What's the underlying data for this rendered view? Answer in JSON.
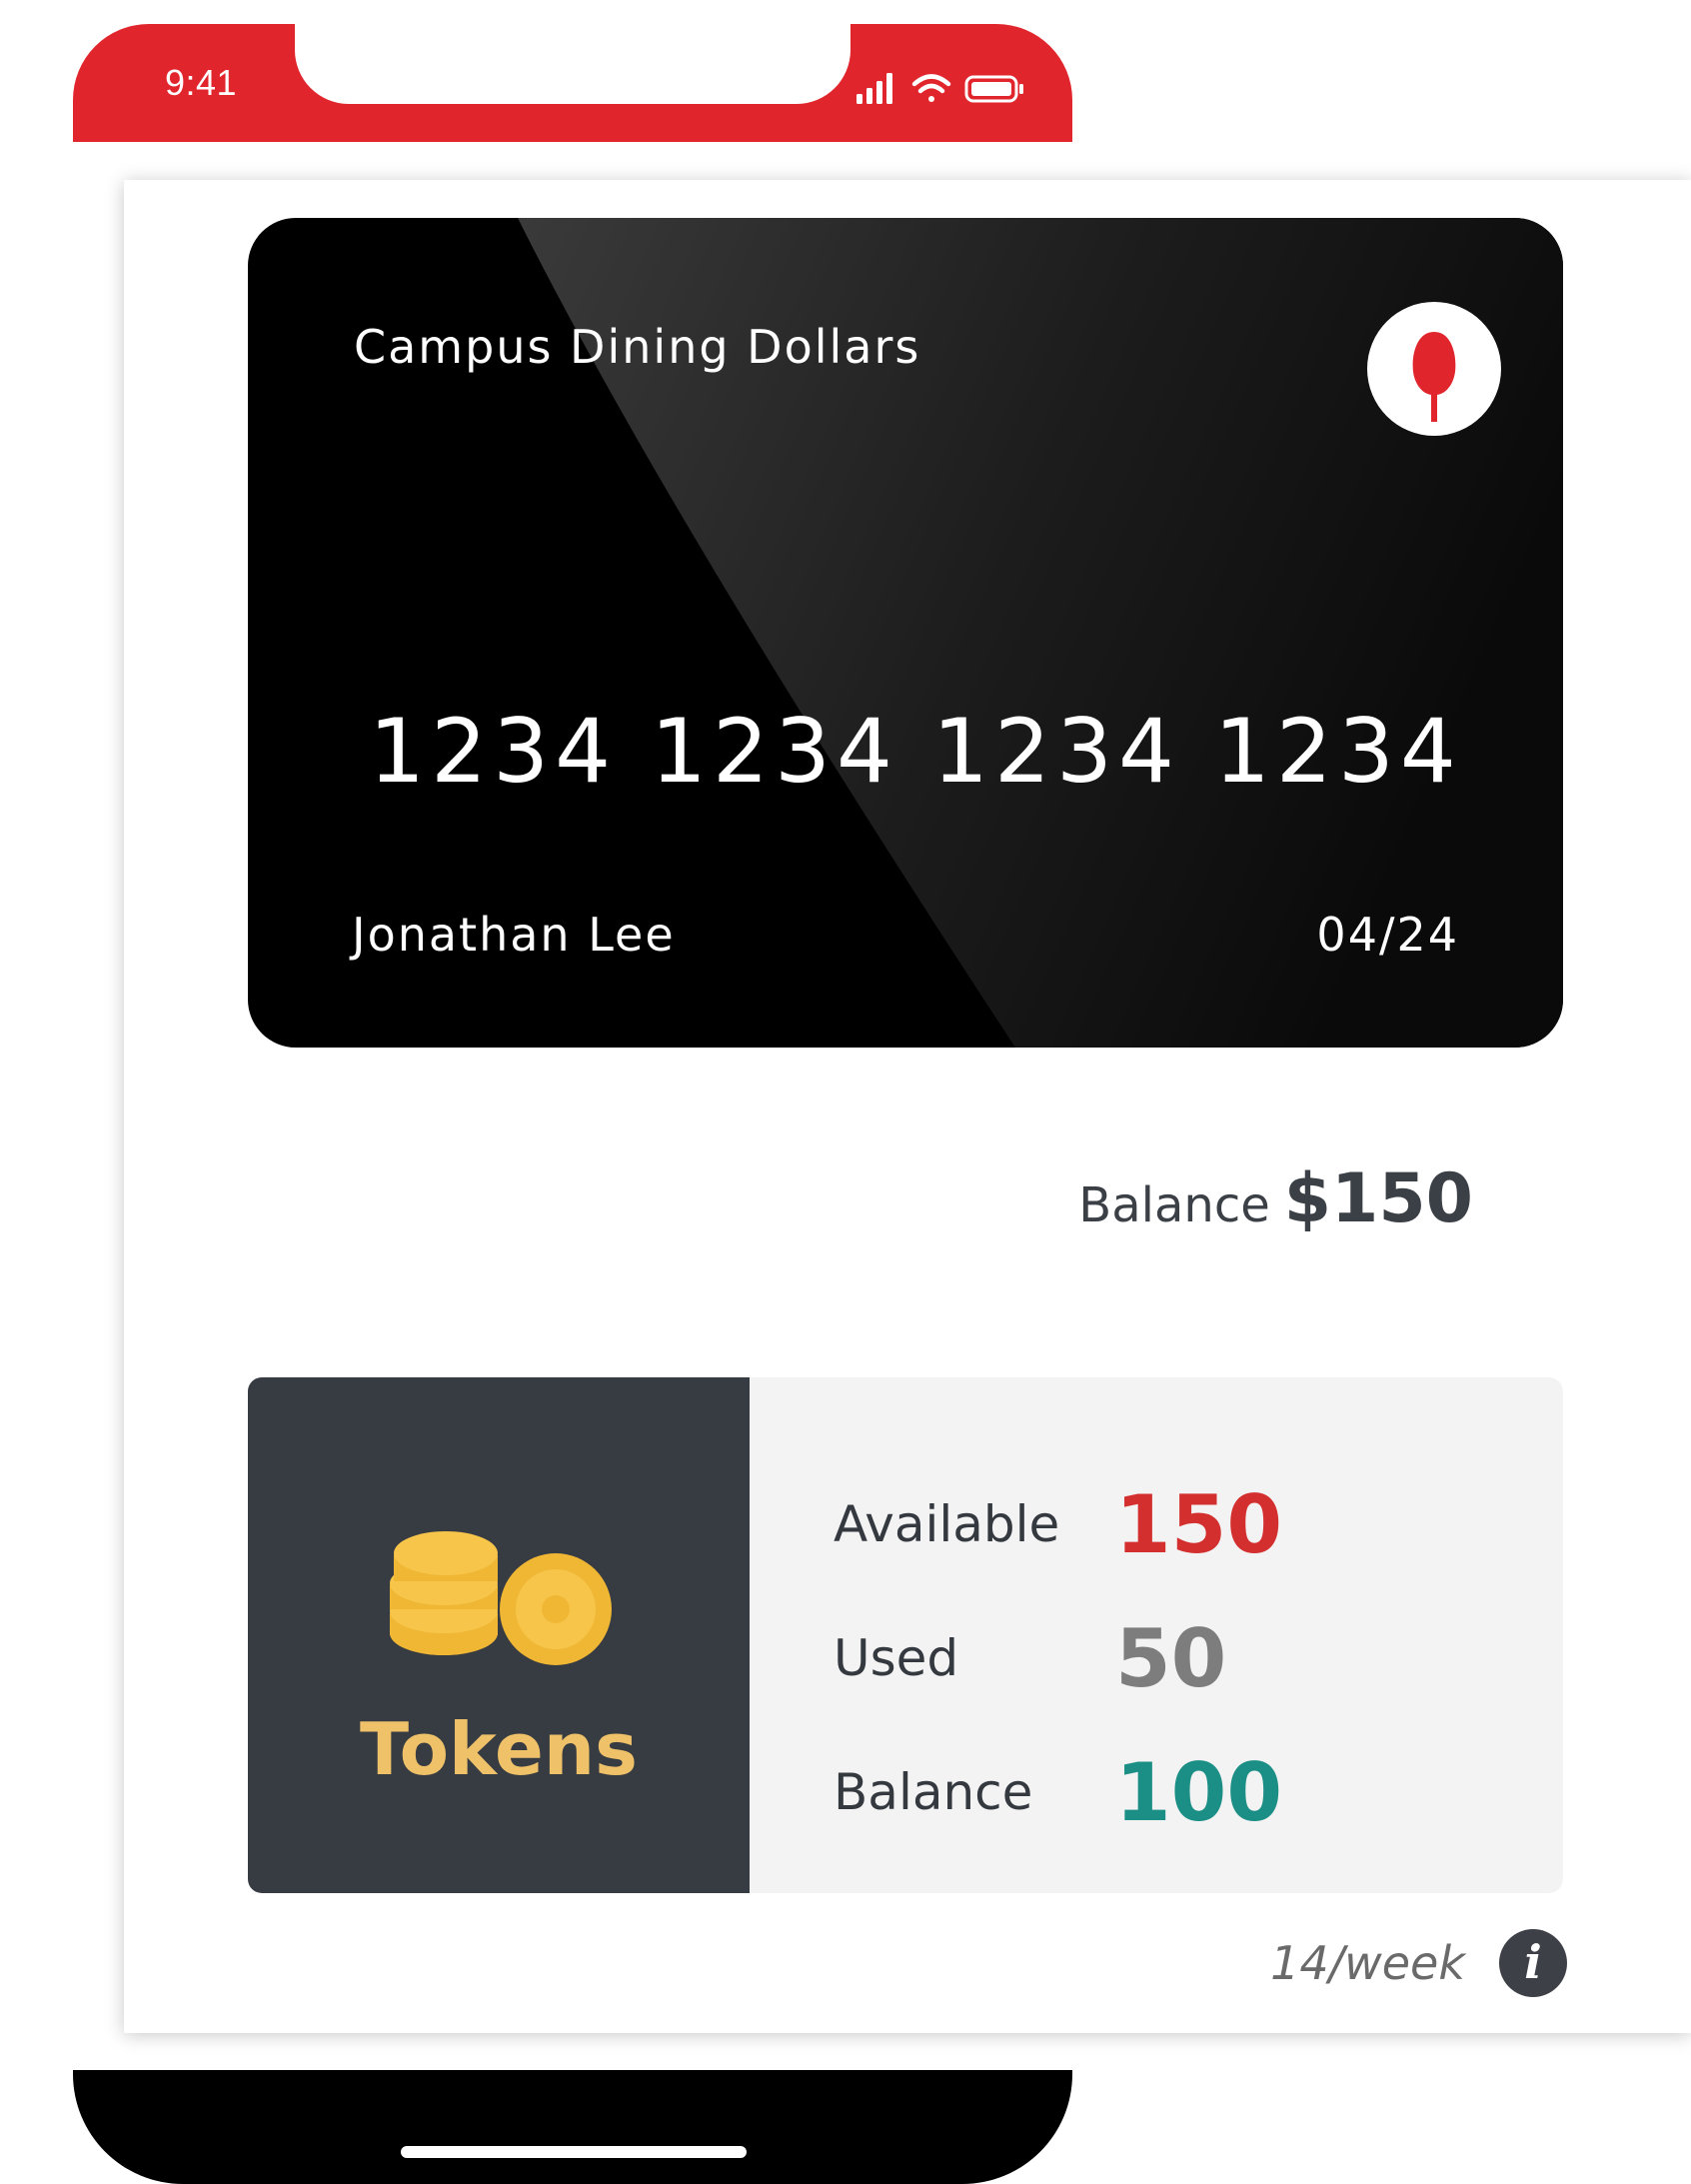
{
  "status_bar": {
    "time": "9:41",
    "background": "#e1252c",
    "icons": [
      "signal-icon",
      "wifi-icon",
      "battery-icon"
    ]
  },
  "card": {
    "title": "Campus Dining Dollars",
    "number": "1234 1234 1234 1234",
    "holder": "Jonathan Lee",
    "expiry": "04/24",
    "logo_icon": "spoon-icon",
    "background": "#000000",
    "logo_color": "#e1252c"
  },
  "balance": {
    "label": "Balance",
    "value": "$150"
  },
  "tokens": {
    "label": "Tokens",
    "icon": "coins-icon",
    "label_color": "#efc26a",
    "stats": [
      {
        "label": "Available",
        "value": "150",
        "color": "#d32f2f"
      },
      {
        "label": "Used",
        "value": "50",
        "color": "#7d7d7d"
      },
      {
        "label": "Balance",
        "value": "100",
        "color": "#1b8f85"
      }
    ]
  },
  "rate": {
    "text": "14/week",
    "icon": "info-icon"
  }
}
